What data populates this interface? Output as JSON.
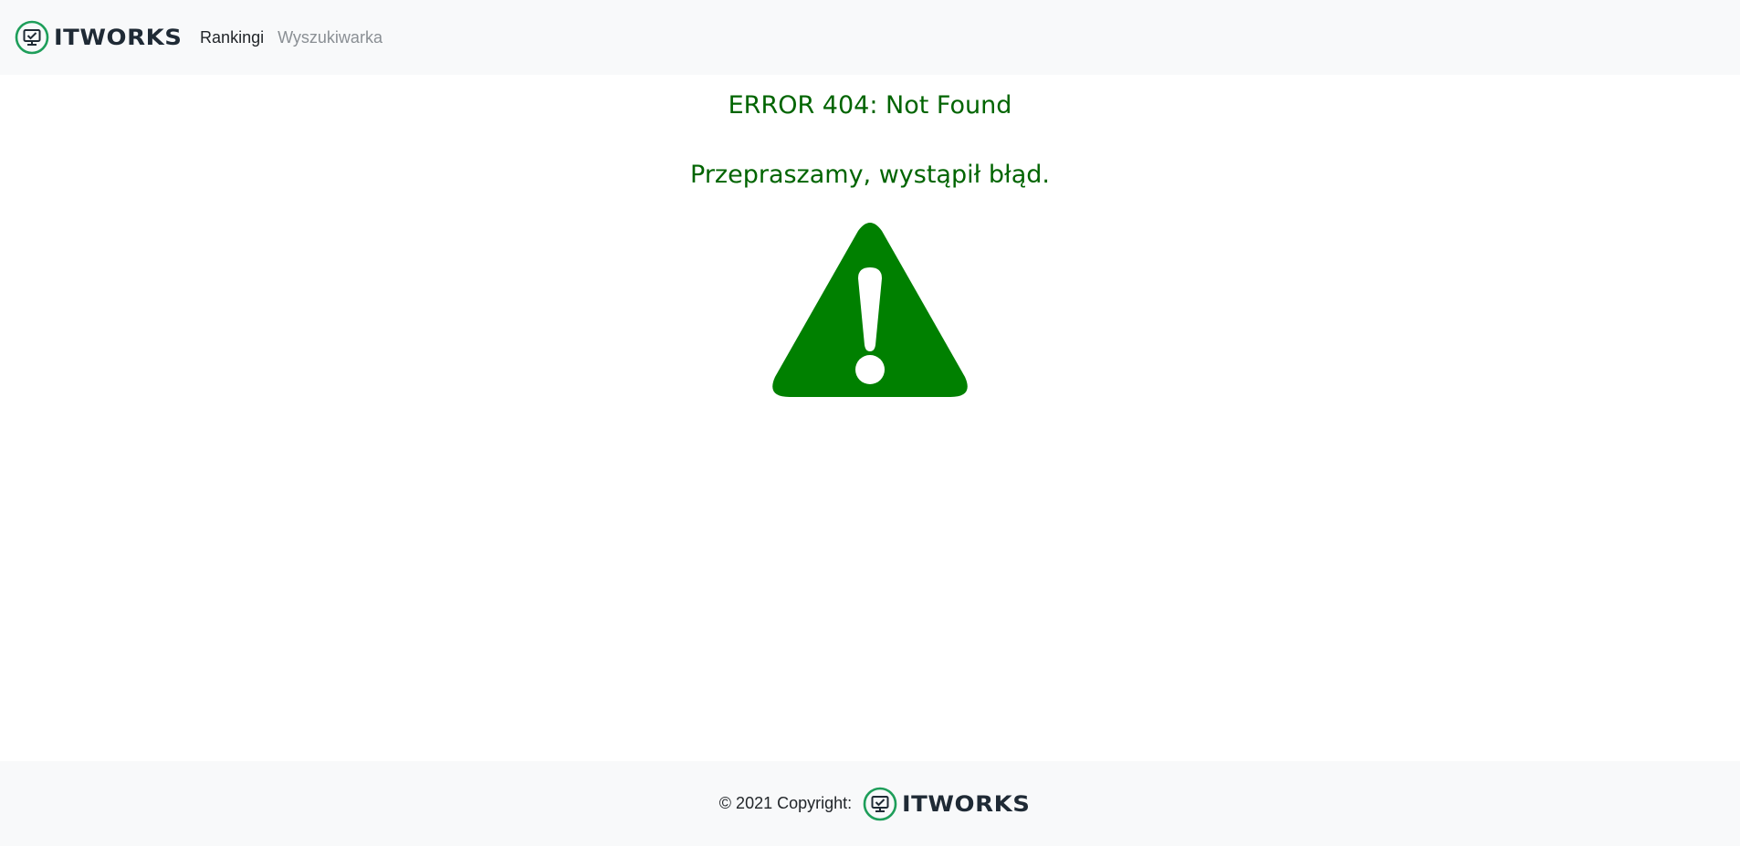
{
  "navbar": {
    "brand": "ITWORKS",
    "links": [
      {
        "label": "Rankingi",
        "state": "active"
      },
      {
        "label": "Wyszukiwarka",
        "state": "inactive"
      }
    ]
  },
  "main": {
    "title": "ERROR 404: Not Found",
    "subtitle": "Przepraszamy, wystąpił błąd.",
    "icon": "warning-triangle-icon"
  },
  "footer": {
    "copyright": "© 2021 Copyright:",
    "brand": "ITWORKS"
  },
  "colors": {
    "accent_green": "#008000",
    "text_green": "#006400",
    "logo_ring": "#1e9e5a",
    "logo_text": "#1f2a35",
    "bar_background": "#f8f9fa"
  }
}
